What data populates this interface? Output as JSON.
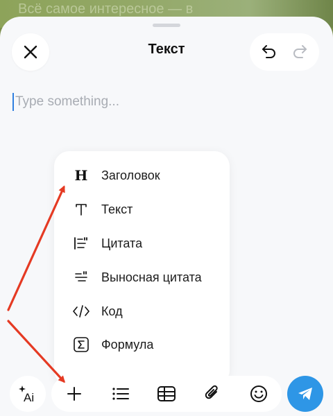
{
  "backdrop": {
    "text": "Всё самое интересное — в"
  },
  "header": {
    "title": "Текст"
  },
  "editor": {
    "placeholder": "Type something..."
  },
  "format_menu": {
    "items": [
      {
        "label": "Заголовок",
        "icon": "heading-icon"
      },
      {
        "label": "Текст",
        "icon": "text-icon"
      },
      {
        "label": "Цитата",
        "icon": "quote-icon"
      },
      {
        "label": "Выносная цитата",
        "icon": "pull-quote-icon"
      },
      {
        "label": "Код",
        "icon": "code-icon"
      },
      {
        "label": "Формула",
        "icon": "formula-icon"
      }
    ]
  },
  "toolbar": {
    "ai_label": "Ai",
    "icons": [
      "ai-icon",
      "plus-icon",
      "list-icon",
      "table-icon",
      "attach-icon",
      "emoji-icon",
      "send-icon"
    ]
  },
  "colors": {
    "accent": "#2e96e6",
    "annotation_arrow": "#e53a23",
    "sheet_background": "#f7f8fa",
    "menu_background": "#ffffff"
  }
}
